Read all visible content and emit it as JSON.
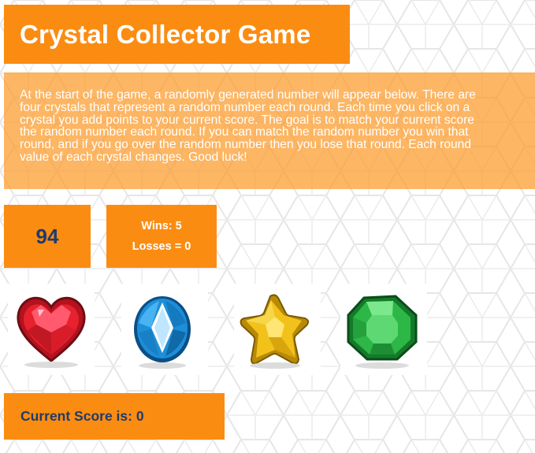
{
  "title": "Crystal Collector Game",
  "instructions": {
    "lines": [
      "At the start of the game, a randomly generated number will appear below. There are",
      "four crystals that represent a random number each round. Each time you click on a",
      "crystal you add points to your current score. The goal is to match your current score",
      "the random number each round. If you can match the random number you win that",
      "round, and if you go over the random number then you lose that round. Each round",
      "value of each crystal changes. Good luck!"
    ]
  },
  "target_number": "94",
  "stats": {
    "wins": "Wins: 5",
    "losses": "Losses = 0"
  },
  "crystals": [
    {
      "icon": "red-heart-crystal-icon",
      "color": "#e8212e"
    },
    {
      "icon": "blue-oval-crystal-icon",
      "color": "#1d8fd8"
    },
    {
      "icon": "yellow-star-crystal-icon",
      "color": "#f2c21b"
    },
    {
      "icon": "green-octagon-crystal-icon",
      "color": "#2cb746"
    }
  ],
  "score": {
    "label": "Current Score is: 0"
  },
  "colors": {
    "accent": "#fb8c12",
    "text_dark": "#1f3b6b",
    "text_light": "#ffffff"
  }
}
